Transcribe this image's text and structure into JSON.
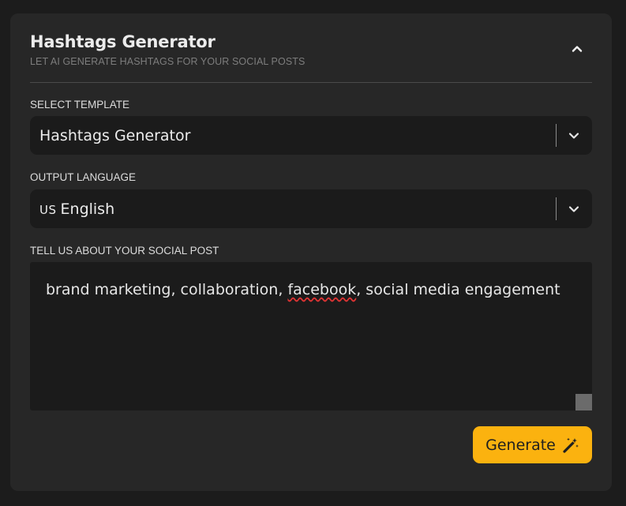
{
  "header": {
    "title": "Hashtags Generator",
    "subtitle": "LET AI GENERATE HASHTAGS FOR YOUR SOCIAL POSTS",
    "collapse_icon": "chevron-up-icon"
  },
  "template_select": {
    "label": "SELECT TEMPLATE",
    "value": "Hashtags Generator",
    "icon": "chevron-down-icon"
  },
  "language_select": {
    "label": "OUTPUT LANGUAGE",
    "flag": "US",
    "value": "English",
    "icon": "chevron-down-icon"
  },
  "post_input": {
    "label": "TELL US ABOUT YOUR SOCIAL POST",
    "text_before": "brand marketing, collaboration, ",
    "misspelled_word": "facebook",
    "text_after": ", social media engagement"
  },
  "generate_button": {
    "label": "Generate",
    "icon": "magic-wand-icon",
    "color": "#fbb20f"
  }
}
